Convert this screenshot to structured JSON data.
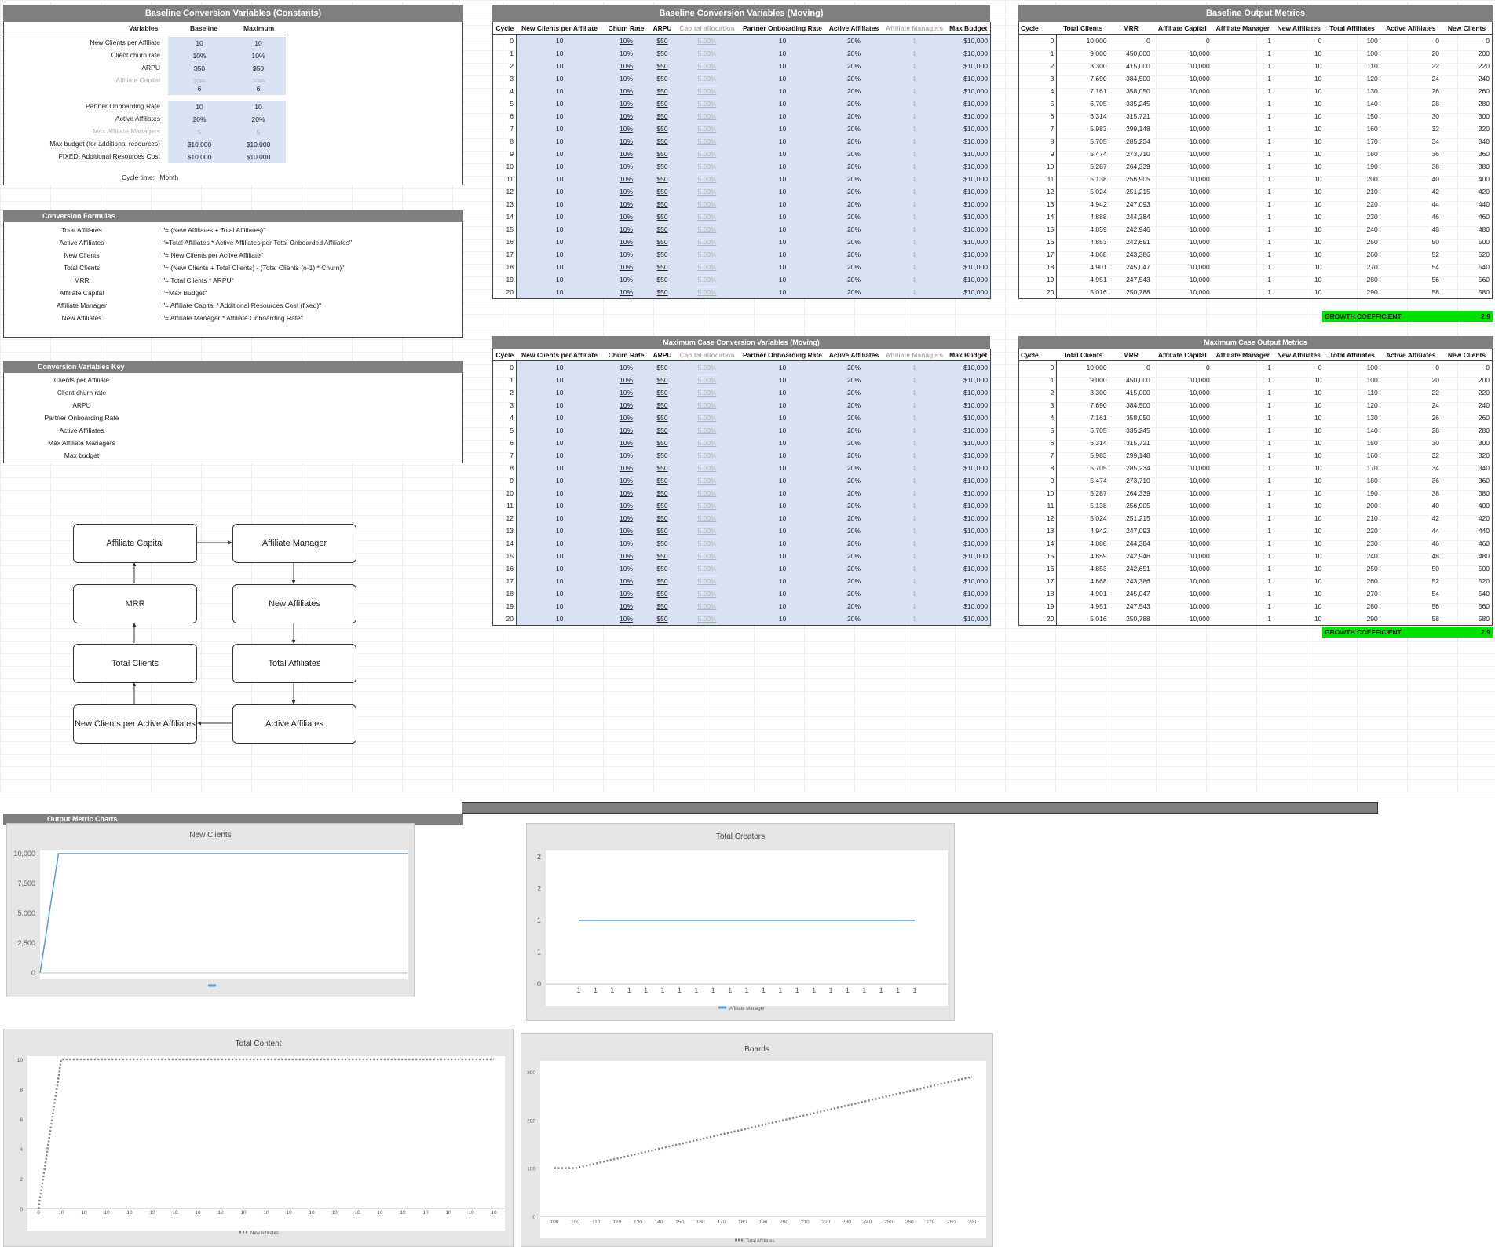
{
  "constants": {
    "title": "Baseline Conversion Variables (Constants)",
    "headers": [
      "Variables",
      "Baseline",
      "Maximum"
    ],
    "rows": [
      {
        "label": "New Clients per Affiliate",
        "baseline": "10",
        "maximum": "10",
        "faded": false
      },
      {
        "label": "Client churn rate",
        "baseline": "10%",
        "maximum": "10%",
        "faded": false
      },
      {
        "label": "ARPU",
        "baseline": "$50",
        "maximum": "$50",
        "faded": false
      },
      {
        "label": "Affiliate Capital",
        "baseline": "20%",
        "maximum": "20%",
        "faded": true
      },
      {
        "label": "",
        "baseline": "6",
        "maximum": "6",
        "faded": false
      },
      {
        "label": "Partner Onboarding Rate",
        "baseline": "10",
        "maximum": "10",
        "faded": false
      },
      {
        "label": "Active Affiliates",
        "baseline": "20%",
        "maximum": "20%",
        "faded": false
      },
      {
        "label": "Max Affiliate Managers",
        "baseline": "5",
        "maximum": "5",
        "faded": true
      },
      {
        "label": "Max budget (for additional resources)",
        "baseline": "$10,000",
        "maximum": "$10,000",
        "faded": false
      },
      {
        "label": "FIXED: Additional Resources Cost",
        "baseline": "$10,000",
        "maximum": "$10,000",
        "faded": false
      }
    ],
    "cycle_time_label": "Cycle time:",
    "cycle_time_value": "Month"
  },
  "formulas": {
    "title": "Conversion Formulas",
    "rows": [
      {
        "name": "Total Affiliates",
        "formula": "\"= (New Affiliates + Total Affiliates)\""
      },
      {
        "name": "Active Affiliates",
        "formula": "\"=Total Affiliates * Active Affiliates per Total Onboarded Affiliates\""
      },
      {
        "name": "New Clients",
        "formula": "\"= New Clients per Active Affiliate\""
      },
      {
        "name": "Total Clients",
        "formula": "\"= (New Clients + Total Clients) - (Total Clients (n-1) * Churn)\""
      },
      {
        "name": "MRR",
        "formula": "\"= Total Clients * ARPU\""
      },
      {
        "name": "Affiliate Capital",
        "formula": "\"=Max Budget\""
      },
      {
        "name": "Affiliate Manager",
        "formula": "\"= Affiliate Capital / Additional Resources Cost (fixed)\""
      },
      {
        "name": "New Affiliates",
        "formula": "\"= Affiliate Manager * Affiliate Onboarding Rate\""
      }
    ]
  },
  "key": {
    "title": "Conversion Variables Key",
    "items": [
      "Clients per Affiliate",
      "Client churn rate",
      "ARPU",
      "Partner Onboarding Rate",
      "Active Affiliates",
      "Max Affiliate Managers",
      "Max budget"
    ]
  },
  "flow": {
    "affiliate_capital": "Affiliate Capital",
    "affiliate_manager": "Affiliate Manager",
    "mrr": "MRR",
    "new_affiliates": "New Affiliates",
    "total_clients": "Total Clients",
    "total_affiliates": "Total Affiliates",
    "new_clients_per_active": "New Clients per Active Affiliates",
    "active_affiliates": "Active Affiliates"
  },
  "moving": {
    "baseline_title": "Baseline Conversion Variables (Moving)",
    "maximum_title": "Maximum  Case Conversion Variables (Moving)",
    "headers": [
      "Cycle",
      "New Clients per Affiliate",
      "Churn Rate",
      "ARPU",
      "Capital allocation",
      "Partner Onboarding Rate",
      "Active Affiliates",
      "Affiliate Managers",
      "Max Budget"
    ],
    "row_values": {
      "new_clients": "10",
      "churn": "10%",
      "arpu": "$50",
      "capital": "5.00%",
      "onboarding": "10",
      "active": "20%",
      "managers": "1",
      "budget": "$10,000"
    },
    "cycles": [
      "0",
      "1",
      "2",
      "3",
      "4",
      "5",
      "6",
      "7",
      "8",
      "9",
      "10",
      "11",
      "12",
      "13",
      "14",
      "15",
      "16",
      "17",
      "18",
      "19",
      "20"
    ]
  },
  "output": {
    "baseline_title": "Baseline Output Metrics",
    "maximum_title": "Maximum Case Output Metrics",
    "headers": [
      "Cycle",
      "Total Clients",
      "MRR",
      "Affiliate Capital",
      "Affiliate Manager",
      "New Affiliates",
      "Total Affiliates",
      "Active Affiliates",
      "New Clients"
    ],
    "baseline_rows": [
      [
        "0",
        "10,000",
        "0",
        "0",
        "1",
        "0",
        "100",
        "0",
        "0"
      ],
      [
        "1",
        "9,000",
        "450,000",
        "10,000",
        "1",
        "10",
        "100",
        "20",
        "200"
      ],
      [
        "2",
        "8,300",
        "415,000",
        "10,000",
        "1",
        "10",
        "110",
        "22",
        "220"
      ],
      [
        "3",
        "7,690",
        "384,500",
        "10,000",
        "1",
        "10",
        "120",
        "24",
        "240"
      ],
      [
        "4",
        "7,161",
        "358,050",
        "10,000",
        "1",
        "10",
        "130",
        "26",
        "260"
      ],
      [
        "5",
        "6,705",
        "335,245",
        "10,000",
        "1",
        "10",
        "140",
        "28",
        "280"
      ],
      [
        "6",
        "6,314",
        "315,721",
        "10,000",
        "1",
        "10",
        "150",
        "30",
        "300"
      ],
      [
        "7",
        "5,983",
        "299,148",
        "10,000",
        "1",
        "10",
        "160",
        "32",
        "320"
      ],
      [
        "8",
        "5,705",
        "285,234",
        "10,000",
        "1",
        "10",
        "170",
        "34",
        "340"
      ],
      [
        "9",
        "5,474",
        "273,710",
        "10,000",
        "1",
        "10",
        "180",
        "36",
        "360"
      ],
      [
        "10",
        "5,287",
        "264,339",
        "10,000",
        "1",
        "10",
        "190",
        "38",
        "380"
      ],
      [
        "11",
        "5,138",
        "256,905",
        "10,000",
        "1",
        "10",
        "200",
        "40",
        "400"
      ],
      [
        "12",
        "5,024",
        "251,215",
        "10,000",
        "1",
        "10",
        "210",
        "42",
        "420"
      ],
      [
        "13",
        "4,942",
        "247,093",
        "10,000",
        "1",
        "10",
        "220",
        "44",
        "440"
      ],
      [
        "14",
        "4,888",
        "244,384",
        "10,000",
        "1",
        "10",
        "230",
        "46",
        "460"
      ],
      [
        "15",
        "4,859",
        "242,946",
        "10,000",
        "1",
        "10",
        "240",
        "48",
        "480"
      ],
      [
        "16",
        "4,853",
        "242,651",
        "10,000",
        "1",
        "10",
        "250",
        "50",
        "500"
      ],
      [
        "17",
        "4,868",
        "243,386",
        "10,000",
        "1",
        "10",
        "260",
        "52",
        "520"
      ],
      [
        "18",
        "4,901",
        "245,047",
        "10,000",
        "1",
        "10",
        "270",
        "54",
        "540"
      ],
      [
        "19",
        "4,951",
        "247,543",
        "10,000",
        "1",
        "10",
        "280",
        "56",
        "560"
      ],
      [
        "20",
        "5,016",
        "250,788",
        "10,000",
        "1",
        "10",
        "290",
        "58",
        "580"
      ]
    ],
    "growth_label": "GROWTH COEFFICIENT",
    "growth_value": "2.9"
  },
  "charts_banner": "Output Metric Charts",
  "chart_data": [
    {
      "type": "line",
      "title": "New Clients",
      "x": [
        "0",
        "1",
        "2",
        "3",
        "4",
        "5",
        "6",
        "7",
        "8",
        "9",
        "10",
        "11",
        "12",
        "13",
        "14",
        "15",
        "16",
        "17",
        "18",
        "19",
        "20"
      ],
      "series": [
        {
          "values": [
            0,
            10000,
            10000,
            10000,
            10000,
            10000,
            10000,
            10000,
            10000,
            10000,
            10000,
            10000,
            10000,
            10000,
            10000,
            10000,
            10000,
            10000,
            10000,
            10000,
            10000
          ]
        }
      ],
      "ylim": [
        0,
        10000
      ],
      "yticks": [
        "0",
        "2,500",
        "5,000",
        "7,500",
        "10,000"
      ],
      "color": "#5b9bd5",
      "grid": false
    },
    {
      "type": "line",
      "title": "Total Creators",
      "x": [
        "1",
        "1",
        "1",
        "1",
        "1",
        "1",
        "1",
        "1",
        "1",
        "1",
        "1",
        "1",
        "1",
        "1",
        "1",
        "1",
        "1",
        "1",
        "1",
        "1",
        "1"
      ],
      "series": [
        {
          "name": "Affiliate Manager",
          "values": [
            1,
            1,
            1,
            1,
            1,
            1,
            1,
            1,
            1,
            1,
            1,
            1,
            1,
            1,
            1,
            1,
            1,
            1,
            1,
            1,
            1
          ]
        }
      ],
      "ylim": [
        0,
        2
      ],
      "yticks": [
        "0",
        "1",
        "1",
        "2",
        "2"
      ],
      "color": "#5b9bd5",
      "legend": "bottom",
      "grid": false
    },
    {
      "type": "line",
      "title": "Total Content",
      "x": [
        "0",
        "10",
        "10",
        "10",
        "10",
        "10",
        "10",
        "10",
        "10",
        "10",
        "10",
        "10",
        "10",
        "10",
        "10",
        "10",
        "10",
        "10",
        "10",
        "10",
        "10"
      ],
      "series": [
        {
          "name": "New Affiliates",
          "values": [
            0,
            10,
            10,
            10,
            10,
            10,
            10,
            10,
            10,
            10,
            10,
            10,
            10,
            10,
            10,
            10,
            10,
            10,
            10,
            10,
            10
          ]
        }
      ],
      "ylim": [
        0,
        10
      ],
      "yticks": [
        "0",
        "2",
        "4",
        "6",
        "8",
        "10"
      ],
      "color": "#7f7f7f",
      "style": "dotted",
      "legend": "bottom",
      "grid": false
    },
    {
      "type": "line",
      "title": "Boards",
      "x": [
        "100",
        "100",
        "110",
        "120",
        "130",
        "140",
        "150",
        "160",
        "170",
        "180",
        "190",
        "200",
        "210",
        "220",
        "230",
        "240",
        "250",
        "260",
        "270",
        "280",
        "290"
      ],
      "series": [
        {
          "name": "Total Affiliates",
          "values": [
            100,
            100,
            110,
            120,
            130,
            140,
            150,
            160,
            170,
            180,
            190,
            200,
            210,
            220,
            230,
            240,
            250,
            260,
            270,
            280,
            290
          ]
        }
      ],
      "ylim": [
        0,
        300
      ],
      "yticks": [
        "0",
        "100",
        "200",
        "300"
      ],
      "color": "#7f7f7f",
      "style": "dotted",
      "legend": "bottom",
      "grid": false
    }
  ]
}
